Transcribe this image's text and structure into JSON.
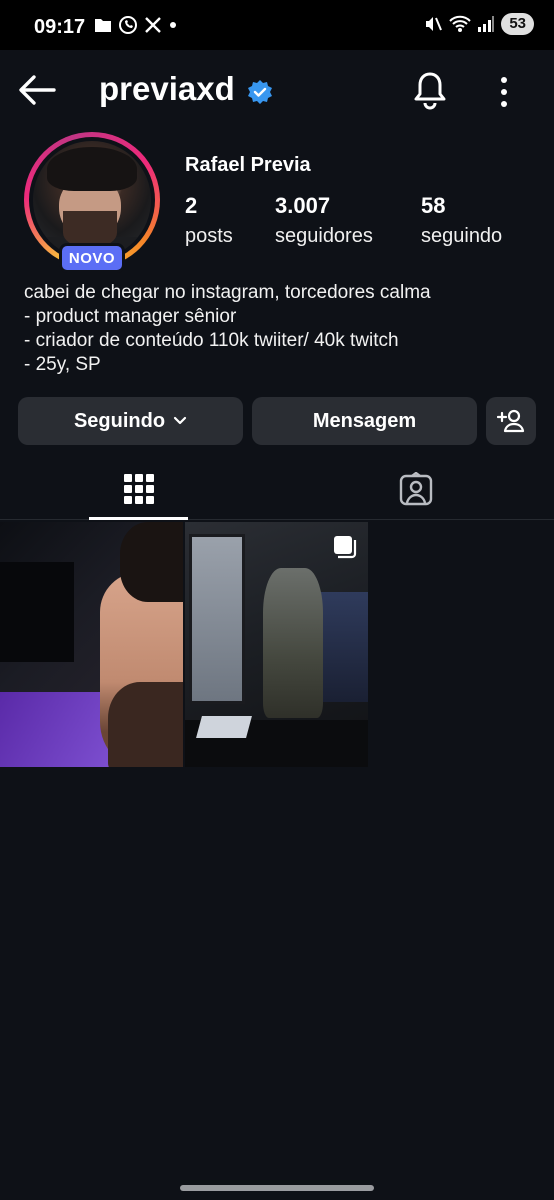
{
  "status_bar": {
    "time": "09:17",
    "battery": "53",
    "left_icons": [
      "folder-icon",
      "whatsapp-icon",
      "x-icon",
      "dot-icon"
    ],
    "right_icons": [
      "mute-icon",
      "wifi-icon",
      "signal-icon"
    ]
  },
  "header": {
    "username": "previaxd",
    "verified": true,
    "icons": [
      "back-arrow-icon",
      "verified-badge-icon",
      "bell-icon",
      "more-vertical-icon"
    ]
  },
  "profile": {
    "badge": "NOVO",
    "full_name": "Rafael Previa",
    "stats": [
      {
        "value": "2",
        "label": "posts"
      },
      {
        "value": "3.007",
        "label": "seguidores"
      },
      {
        "value": "58",
        "label": "seguindo"
      }
    ],
    "bio": [
      "cabei de chegar no instagram, torcedores calma",
      "- product manager sênior",
      "- criador de conteúdo 110k twiiter/ 40k twitch",
      "- 25y, SP"
    ]
  },
  "actions": {
    "following_label": "Seguindo",
    "message_label": "Mensagem",
    "add_icon": "add-person-icon"
  },
  "tabs": [
    {
      "icon": "grid-icon",
      "active": true
    },
    {
      "icon": "tagged-icon",
      "active": false
    }
  ],
  "posts": [
    {
      "kind": "photo",
      "multi": false
    },
    {
      "kind": "photo",
      "multi": true
    }
  ],
  "colors": {
    "background": "#0e1117",
    "button": "#2a2d33",
    "badge": "#5b6ef5",
    "verified": "#3897f0"
  }
}
